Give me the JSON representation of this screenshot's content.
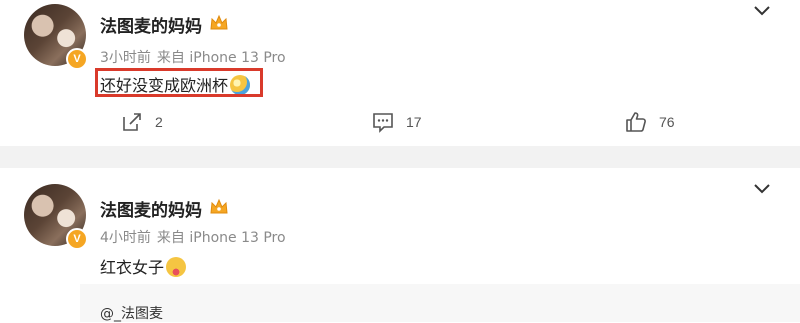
{
  "posts": [
    {
      "username": "法图麦的妈妈",
      "time": "3小时前",
      "source": "来自 iPhone 13 Pro",
      "content": "还好没变成欧洲杯",
      "actions": {
        "repost": "2",
        "comment": "17",
        "like": "76"
      }
    },
    {
      "username": "法图麦的妈妈",
      "time": "4小时前",
      "source": "来自 iPhone 13 Pro",
      "content": "红衣女子",
      "mention": "@_法图麦"
    }
  ],
  "colors": {
    "highlight": "#d93a2b",
    "badge": "#f5a623",
    "divider": "#f2f2f2"
  }
}
